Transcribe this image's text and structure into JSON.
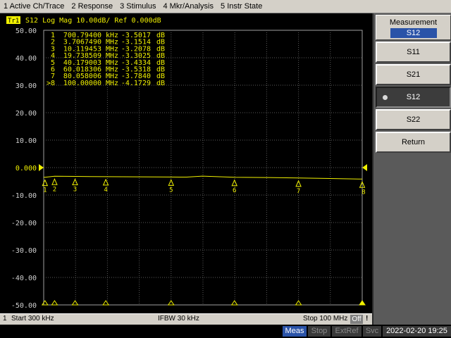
{
  "menu": [
    "1 Active Ch/Trace",
    "2 Response",
    "3 Stimulus",
    "4 Mkr/Analysis",
    "5 Instr State"
  ],
  "trace": {
    "badge": "Tr1",
    "header": "S12 Log Mag 10.00dB/ Ref 0.000dB",
    "ref_label": "0.000",
    "color": "#f0f000"
  },
  "markers": [
    {
      "label": "1",
      "x": "700.79400",
      "unit": "kHz",
      "y": "-3.5017",
      "y_unit": "dB",
      "flag": "1"
    },
    {
      "label": "2",
      "x": "3.7067490",
      "unit": "MHz",
      "y": "-3.1514",
      "y_unit": "dB",
      "flag": "2"
    },
    {
      "label": "3",
      "x": "10.119453",
      "unit": "MHz",
      "y": "-3.2078",
      "y_unit": "dB",
      "flag": "3"
    },
    {
      "label": "4",
      "x": "19.738509",
      "unit": "MHz",
      "y": "-3.3025",
      "y_unit": "dB",
      "flag": "4"
    },
    {
      "label": "5",
      "x": "40.179003",
      "unit": "MHz",
      "y": "-3.4334",
      "y_unit": "dB",
      "flag": "5"
    },
    {
      "label": "6",
      "x": "60.018306",
      "unit": "MHz",
      "y": "-3.5318",
      "y_unit": "dB",
      "flag": "6"
    },
    {
      "label": "7",
      "x": "80.058006",
      "unit": "MHz",
      "y": "-3.7840",
      "y_unit": "dB",
      "flag": "7"
    },
    {
      "label": ">8",
      "x": "100.00000",
      "unit": "MHz",
      "y": "-4.1729",
      "y_unit": "dB",
      "flag": "8"
    }
  ],
  "chart_data": {
    "type": "line",
    "title": "S12 Log Mag 10.00dB/ Ref 0.000dB",
    "yticks": [
      "50.00",
      "40.00",
      "30.00",
      "20.00",
      "10.00",
      "0.000",
      "-10.00",
      "-20.00",
      "-30.00",
      "-40.00",
      "-50.00"
    ],
    "ylim": [
      -50,
      50
    ],
    "xlim_mhz": [
      0.3,
      100
    ],
    "grid": true,
    "series": [
      {
        "x_mhz": [
          0.3,
          0.70079,
          3.706749,
          10.119453,
          19.738509,
          30,
          40.179003,
          45,
          50,
          60.018306,
          70,
          80.058006,
          90,
          100
        ],
        "y_db": [
          -3.55,
          -3.5017,
          -3.1514,
          -3.2078,
          -3.3025,
          -3.37,
          -3.4334,
          -3.47,
          -3.1,
          -3.5318,
          -3.62,
          -3.784,
          -3.98,
          -4.1729
        ]
      }
    ]
  },
  "channel": {
    "number": "1",
    "start": "Start 300 kHz",
    "ifbw": "IFBW 30 kHz",
    "stop": "Stop 100 MHz",
    "off": "Off",
    "excl": "!"
  },
  "status": {
    "meas": "Meas",
    "stop": "Stop",
    "extref": "ExtRef",
    "svc": "Svc",
    "datetime": "2022-02-20 19:25"
  },
  "softkeys": {
    "header_title": "Measurement",
    "header_value": "S12",
    "buttons": [
      {
        "label": "S11",
        "active": false
      },
      {
        "label": "S21",
        "active": false
      },
      {
        "label": "S12",
        "active": true
      },
      {
        "label": "S22",
        "active": false
      },
      {
        "label": "Return",
        "active": false
      }
    ]
  }
}
